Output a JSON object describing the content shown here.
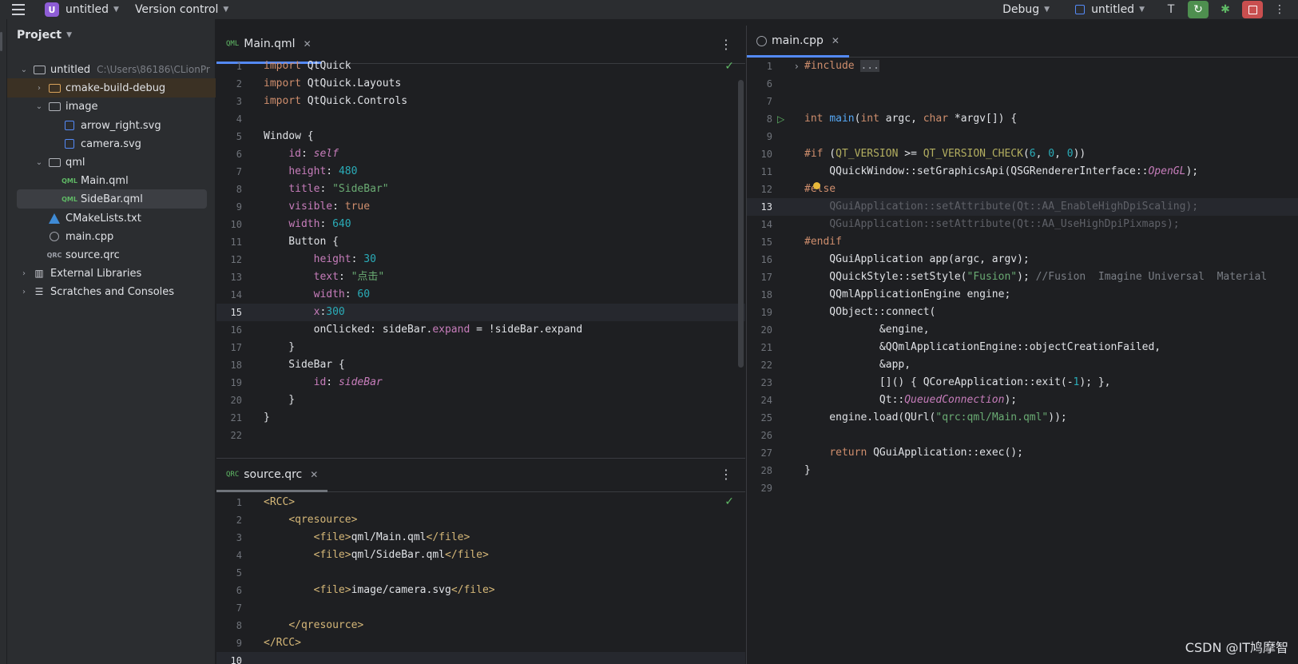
{
  "topbar": {
    "project_badge": "U",
    "project_name": "untitled",
    "version_control": "Version control",
    "config": "Debug",
    "run_target": "untitled"
  },
  "project_panel": {
    "title": "Project",
    "tree": [
      {
        "label": "untitled",
        "hint": "C:\\Users\\86186\\CLionPr",
        "indent": 0,
        "arrow": "v",
        "icon": "folder"
      },
      {
        "label": "cmake-build-debug",
        "indent": 1,
        "arrow": ">",
        "icon": "folder-orange"
      },
      {
        "label": "image",
        "indent": 1,
        "arrow": "v",
        "icon": "folder"
      },
      {
        "label": "arrow_right.svg",
        "indent": 2,
        "arrow": "",
        "icon": "svg"
      },
      {
        "label": "camera.svg",
        "indent": 2,
        "arrow": "",
        "icon": "svg"
      },
      {
        "label": "qml",
        "indent": 1,
        "arrow": "v",
        "icon": "folder"
      },
      {
        "label": "Main.qml",
        "indent": 2,
        "arrow": "",
        "icon": "qml"
      },
      {
        "label": "SideBar.qml",
        "indent": 2,
        "arrow": "",
        "icon": "qml"
      },
      {
        "label": "CMakeLists.txt",
        "indent": 1,
        "arrow": "",
        "icon": "cmake"
      },
      {
        "label": "main.cpp",
        "indent": 1,
        "arrow": "",
        "icon": "cpp"
      },
      {
        "label": "source.qrc",
        "indent": 1,
        "arrow": "",
        "icon": "qrc"
      },
      {
        "label": "External Libraries",
        "indent": 0,
        "arrow": ">",
        "icon": "libs"
      },
      {
        "label": "Scratches and Consoles",
        "indent": 0,
        "arrow": ">",
        "icon": "scratch"
      }
    ]
  },
  "editors": {
    "main_qml": {
      "tab_label": "Main.qml",
      "tab_icon_text": "QML",
      "current_line": 15,
      "lines": [
        {
          "n": "1",
          "html": "<span class='kw'>import</span> QtQuick"
        },
        {
          "n": "2",
          "html": "<span class='kw'>import</span> QtQuick.Layouts"
        },
        {
          "n": "3",
          "html": "<span class='kw'>import</span> QtQuick.Controls"
        },
        {
          "n": "4",
          "html": ""
        },
        {
          "n": "5",
          "html": "Window {"
        },
        {
          "n": "6",
          "html": "    <span class='pr'>id</span>: <span class='id'>self</span>"
        },
        {
          "n": "7",
          "html": "    <span class='pr'>height</span>: <span class='num'>480</span>"
        },
        {
          "n": "8",
          "html": "    <span class='pr'>title</span>: <span class='str'>\"SideBar\"</span>"
        },
        {
          "n": "9",
          "html": "    <span class='pr'>visible</span>: <span class='kw'>true</span>"
        },
        {
          "n": "10",
          "html": "    <span class='pr'>width</span>: <span class='num'>640</span>"
        },
        {
          "n": "11",
          "html": "    Button {"
        },
        {
          "n": "12",
          "html": "        <span class='pr'>height</span>: <span class='num'>30</span>"
        },
        {
          "n": "13",
          "html": "        <span class='pr'>text</span>: <span class='str'>\"点击\"</span>"
        },
        {
          "n": "14",
          "html": "        <span class='pr'>width</span>: <span class='num'>60</span>"
        },
        {
          "n": "15",
          "html": "        <span class='pr'>x</span>:<span class='num'>300</span>"
        },
        {
          "n": "16",
          "html": "        onClicked: sideBar.<span class='pr'>expand</span> = !sideBar.expand"
        },
        {
          "n": "17",
          "html": "    }"
        },
        {
          "n": "18",
          "html": "    SideBar {"
        },
        {
          "n": "19",
          "html": "        <span class='pr'>id</span>: <span class='id'>sideBar</span>"
        },
        {
          "n": "20",
          "html": "    }"
        },
        {
          "n": "21",
          "html": "}"
        },
        {
          "n": "22",
          "html": ""
        }
      ]
    },
    "source_qrc": {
      "tab_label": "source.qrc",
      "tab_icon_text": "QRC",
      "current_line": 10,
      "lines": [
        {
          "n": "1",
          "html": "<span class='tag'>&lt;RCC&gt;</span>"
        },
        {
          "n": "2",
          "html": "    <span class='tag'>&lt;qresource&gt;</span>"
        },
        {
          "n": "3",
          "html": "        <span class='tag'>&lt;file&gt;</span>qml/Main.qml<span class='tag'>&lt;/file&gt;</span>"
        },
        {
          "n": "4",
          "html": "        <span class='tag'>&lt;file&gt;</span>qml/SideBar.qml<span class='tag'>&lt;/file&gt;</span>"
        },
        {
          "n": "5",
          "html": ""
        },
        {
          "n": "6",
          "html": "        <span class='tag'>&lt;file&gt;</span>image/camera.svg<span class='tag'>&lt;/file&gt;</span>"
        },
        {
          "n": "7",
          "html": ""
        },
        {
          "n": "8",
          "html": "    <span class='tag'>&lt;/qresource&gt;</span>"
        },
        {
          "n": "9",
          "html": "<span class='tag'>&lt;/RCC&gt;</span>"
        },
        {
          "n": "10",
          "html": ""
        }
      ]
    },
    "main_cpp": {
      "tab_label": "main.cpp",
      "current_line": 13,
      "lines": [
        {
          "n": "1",
          "html": "<span class='kw'>#include</span> <span style='background:#393b40;color:#9da0a8'>...</span>"
        },
        {
          "n": "6",
          "html": ""
        },
        {
          "n": "7",
          "html": ""
        },
        {
          "n": "8",
          "html": "<span class='kw'>int</span> <span class='fn'>main</span>(<span class='kw'>int</span> argc, <span class='kw'>char</span> *argv[]) {"
        },
        {
          "n": "9",
          "html": ""
        },
        {
          "n": "10",
          "html": "<span class='kw'>#if</span> (<span class='mac'>QT_VERSION</span> &gt;= <span class='mac'>QT_VERSION_CHECK</span>(<span class='num'>6</span>, <span class='num'>0</span>, <span class='num'>0</span>))"
        },
        {
          "n": "11",
          "html": "    QQuickWindow::setGraphicsApi(QSGRendererInterface::<span class='ital'>OpenGL</span>);"
        },
        {
          "n": "12",
          "html": "<span class='kw'>#else</span>"
        },
        {
          "n": "13",
          "html": "    <span class='dim'>QGuiApplication::setAttribute(Qt::AA_EnableHighDpiScaling);</span>"
        },
        {
          "n": "14",
          "html": "    <span class='dim'>QGuiApplication::setAttribute(Qt::AA_UseHighDpiPixmaps);</span>"
        },
        {
          "n": "15",
          "html": "<span class='kw'>#endif</span>"
        },
        {
          "n": "16",
          "html": "    QGuiApplication app(argc, argv);"
        },
        {
          "n": "17",
          "html": "    QQuickStyle::setStyle(<span class='str'>\"Fusion\"</span>); <span class='cm'>//Fusion  Imagine Universal  Material</span>"
        },
        {
          "n": "18",
          "html": "    QQmlApplicationEngine engine;"
        },
        {
          "n": "19",
          "html": "    QObject::connect("
        },
        {
          "n": "20",
          "html": "            &amp;engine,"
        },
        {
          "n": "21",
          "html": "            &amp;QQmlApplicationEngine::objectCreationFailed,"
        },
        {
          "n": "22",
          "html": "            &amp;app,"
        },
        {
          "n": "23",
          "html": "            []() { QCoreApplication::exit(-<span class='num'>1</span>); },"
        },
        {
          "n": "24",
          "html": "            Qt::<span class='ital'>QueuedConnection</span>);"
        },
        {
          "n": "25",
          "html": "    engine.load(QUrl(<span class='str'>\"qrc:qml/Main.qml\"</span>));"
        },
        {
          "n": "26",
          "html": ""
        },
        {
          "n": "27",
          "html": "    <span class='kw'>return</span> QGuiApplication::exec();"
        },
        {
          "n": "28",
          "html": "}"
        },
        {
          "n": "29",
          "html": ""
        }
      ]
    }
  },
  "watermark": "CSDN @IT鸠摩智",
  "colors": {
    "accent_tab": "#548af7",
    "run_button": "#4e8f4f",
    "stop_button": "#c94f4f",
    "project_badge": "#8e5dd6"
  }
}
